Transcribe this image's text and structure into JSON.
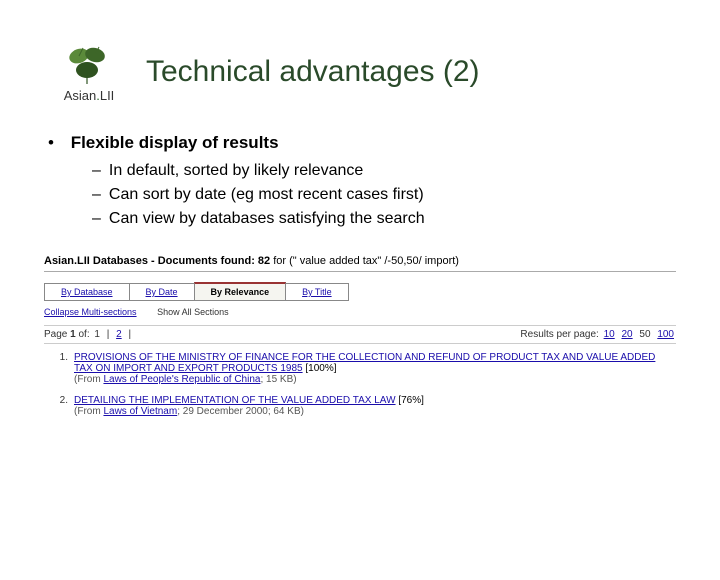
{
  "logo": {
    "top": "Asian",
    "suffix": "LII"
  },
  "heading": "Technical advantages (2)",
  "bullet_main": "Flexible display of results",
  "bullets_sub": [
    "In default, sorted by likely relevance",
    "Can sort by date (eg most recent cases first)",
    "Can view by databases satisfying the search"
  ],
  "results": {
    "header_prefix": "Asian.LII Databases - Documents found: ",
    "count": "82",
    "header_suffix": " for (\" value added tax\" /-50,50/ import)",
    "tabs": {
      "database": "By Database",
      "date": "By Date",
      "relevance": "By Relevance",
      "title": "By Title"
    },
    "secondary": {
      "collapse": "Collapse Multi-sections",
      "show_all": "Show All Sections"
    },
    "pager": {
      "left_prefix": "Page ",
      "left_bold": "1",
      "left_of": " of: ",
      "left_rest_1": "1",
      "left_rest_sep": " | ",
      "left_rest_2": "2",
      "right_prefix": "Results per page: ",
      "opts": [
        "10",
        "20",
        "50",
        "100"
      ]
    },
    "items": [
      {
        "n": "1.",
        "title": "PROVISIONS OF THE MINISTRY OF FINANCE FOR THE COLLECTION AND REFUND OF PRODUCT TAX AND VALUE ADDED TAX ON IMPORT AND EXPORT PRODUCTS 1985",
        "pct": "[100%]",
        "from_prefix": "(From ",
        "from_source": "Laws of People's Republic of China",
        "from_suffix": "; 15 KB)"
      },
      {
        "n": "2.",
        "title": "DETAILING THE IMPLEMENTATION OF THE VALUE ADDED TAX LAW",
        "pct": "[76%]",
        "from_prefix": "(From ",
        "from_source": "Laws of Vietnam",
        "from_suffix": "; 29 December 2000; 64 KB)"
      }
    ]
  }
}
